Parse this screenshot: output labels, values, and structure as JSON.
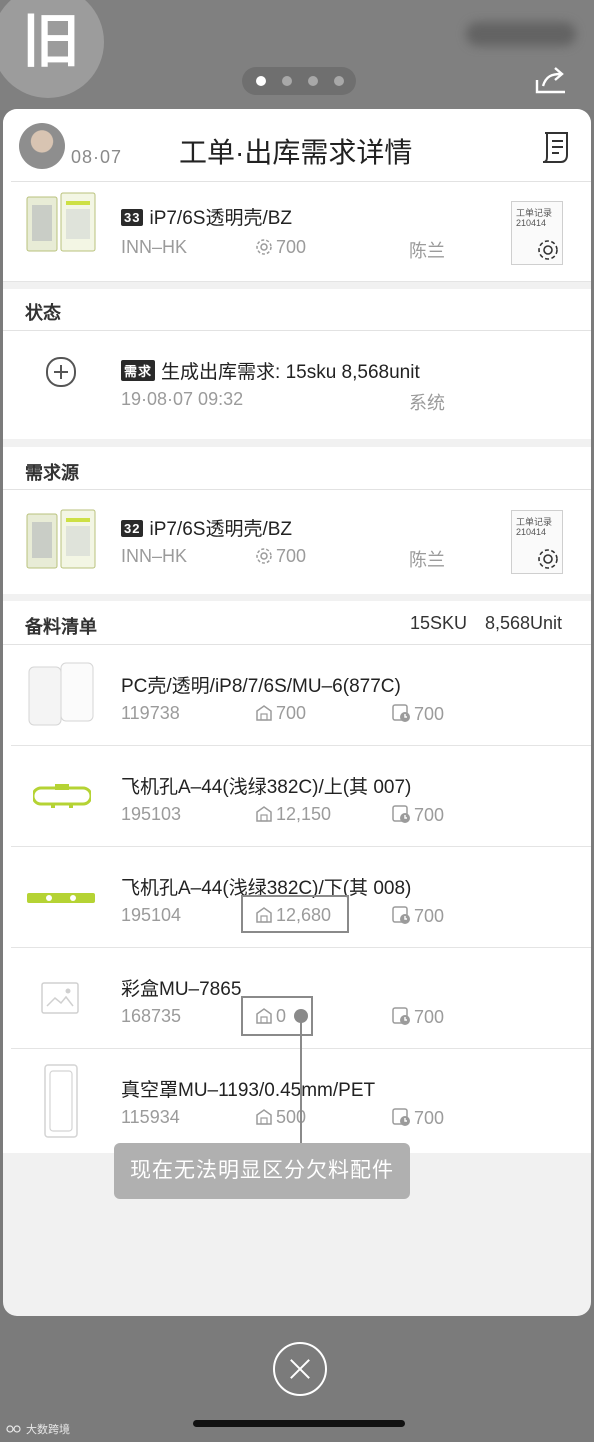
{
  "overlay": {
    "badge_text": "旧"
  },
  "pager": {
    "count": 4,
    "active_index": 0
  },
  "header": {
    "date": "08·07",
    "title": "工单·出库需求详情"
  },
  "work_order": {
    "tag": "33",
    "title": "iP7/6S透明壳/BZ",
    "location": "INN–HK",
    "quantity": "700",
    "person": "陈兰",
    "record_label": "工单记录",
    "record_number": "210414"
  },
  "status_section": {
    "label": "状态",
    "tag": "需求",
    "event_text": "生成出库需求: 15sku   8,568unit",
    "timestamp": "19·08·07 09:32",
    "actor": "系统"
  },
  "source_section": {
    "label": "需求源",
    "tag": "32",
    "title": "iP7/6S透明壳/BZ",
    "location": "INN–HK",
    "quantity": "700",
    "person": "陈兰",
    "record_label": "工单记录",
    "record_number": "210414"
  },
  "materials_section": {
    "label": "备料清单",
    "sku_count": "15SKU",
    "unit_count": "8,568Unit",
    "items": [
      {
        "name": "PC壳/透明/iP8/7/6S/MU–6(877C)",
        "code": "119738",
        "stock": "700",
        "required": "700",
        "icon": "phone-case-icon"
      },
      {
        "name": "飞机孔A–44(浅绿382C)/上(其 007)",
        "code": "195103",
        "stock": "12,150",
        "required": "700",
        "icon": "green-clip-outline-icon"
      },
      {
        "name": "飞机孔A–44(浅绿382C)/下(其 008)",
        "code": "195104",
        "stock": "12,680",
        "required": "700",
        "icon": "green-bar-icon"
      },
      {
        "name": "彩盒MU–7865",
        "code": "168735",
        "stock": "0",
        "required": "700",
        "icon": "image-placeholder-icon"
      },
      {
        "name": "真空罩MU–1193/0.45mm/PET",
        "code": "115934",
        "stock": "500",
        "required": "700",
        "icon": "vacuum-cover-icon"
      }
    ]
  },
  "annotation": {
    "text": "现在无法明显区分欠料配件"
  },
  "watermark": {
    "text": "大数跨境"
  },
  "colors": {
    "background": "#7b7b7b",
    "card": "#ffffff",
    "accent_green": "#b5d334",
    "tag_dark": "#2a2a2a"
  }
}
